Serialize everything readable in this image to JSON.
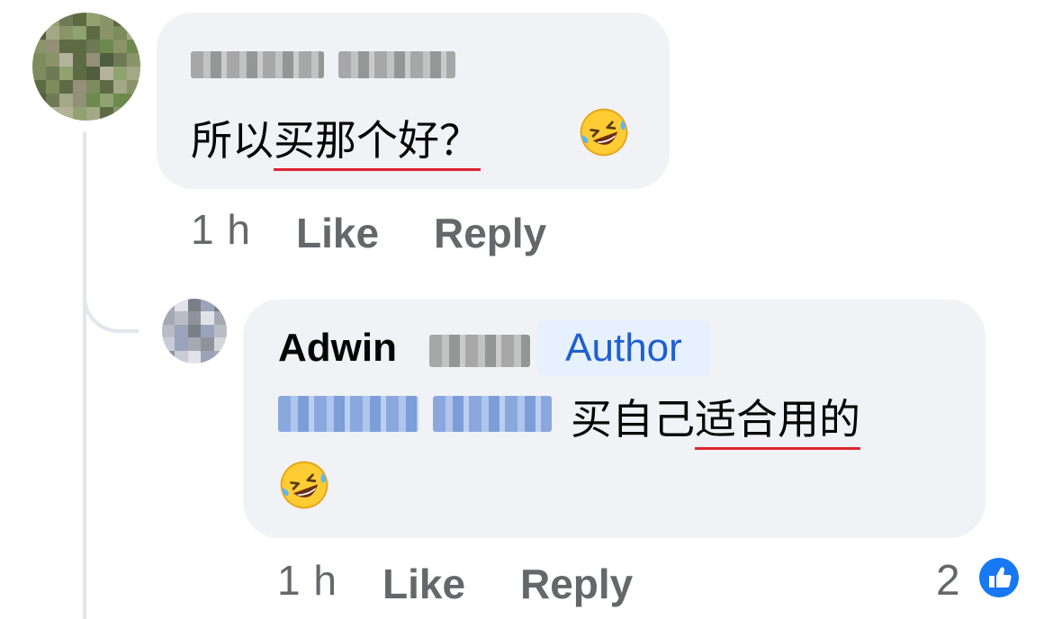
{
  "comment": {
    "text_plain": "所以",
    "text_underlined": "买那个好？",
    "time": "1 h",
    "like_label": "Like",
    "reply_label": "Reply",
    "emoji": "rolling-on-floor-laughing"
  },
  "reply": {
    "author_first_name": "Adwin",
    "author_badge": "Author",
    "text_plain": "买自己",
    "text_underlined": "适合用的",
    "time": "1 h",
    "like_label": "Like",
    "reply_label": "Reply",
    "reaction_count": "2",
    "emoji": "rolling-on-floor-laughing"
  },
  "colors": {
    "bubble": "#f0f2f5",
    "badge_bg": "#e7f0fd",
    "badge_text": "#1f5fd1",
    "like_blue": "#1877f2",
    "underline": "#e0242f"
  }
}
